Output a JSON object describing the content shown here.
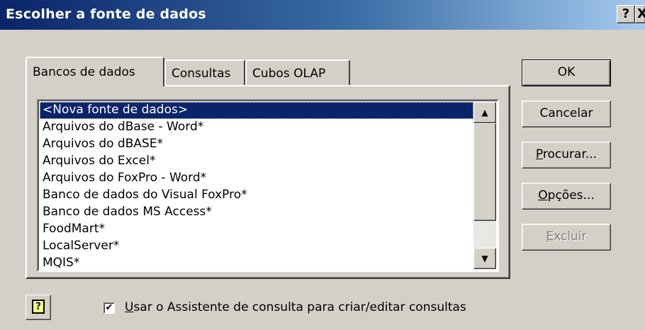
{
  "window": {
    "title": "Escolher a fonte de dados",
    "help_glyph": "?",
    "close_glyph": "X"
  },
  "tabs": [
    {
      "label": "Bancos de dados",
      "active": true
    },
    {
      "label": "Consultas",
      "active": false
    },
    {
      "label": "Cubos OLAP",
      "active": false
    }
  ],
  "list": {
    "items": [
      "<Nova fonte de dados>",
      "Arquivos do dBase - Word*",
      "Arquivos do dBASE*",
      "Arquivos do Excel*",
      "Arquivos do FoxPro - Word*",
      "Banco de dados do Visual FoxPro*",
      "Banco de dados MS Access*",
      "FoodMart*",
      "LocalServer*",
      "MQIS*"
    ],
    "selected_index": 0
  },
  "buttons": {
    "ok": "OK",
    "cancel": "Cancelar",
    "browse_mnemonic": "P",
    "browse_rest": "rocurar...",
    "options_mnemonic": "O",
    "options_rest": "pções...",
    "delete_mnemonic": "E",
    "delete_rest": "xcluir"
  },
  "icons": {
    "help_button": "help-question-icon",
    "scroll_up": "scroll-up-arrow-icon",
    "scroll_down": "scroll-down-arrow-icon",
    "help_glyph": "?",
    "up_glyph": "▲",
    "down_glyph": "▼",
    "check_glyph": "✔"
  },
  "wizard": {
    "checked": true,
    "label_mnemonic": "U",
    "label_rest": "sar o Assistente de consulta para criar/editar consultas"
  },
  "colors": {
    "title_bar_start": "#0a246a",
    "title_bar_end": "#a6caf0",
    "face": "#d4d0c8",
    "selection": "#0a246a"
  }
}
